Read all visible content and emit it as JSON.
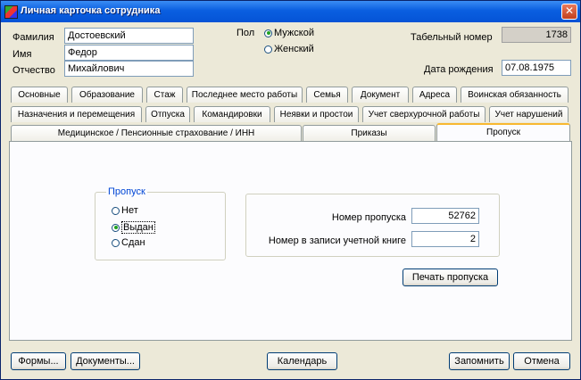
{
  "window": {
    "title": "Личная карточка сотрудника"
  },
  "person": {
    "surname_label": "Фамилия",
    "surname": "Достоевский",
    "name_label": "Имя",
    "name": "Федор",
    "patronymic_label": "Отчество",
    "patronymic": "Михайлович",
    "gender_label": "Пол",
    "gender_male": "Мужской",
    "gender_female": "Женский",
    "gender_selected": "male",
    "tabnum_label": "Табельный номер",
    "tabnum": "1738",
    "birth_label": "Дата рождения",
    "birth": "07.08.1975"
  },
  "tabs_row1": [
    "Основные",
    "Образование",
    "Стаж",
    "Последнее место работы",
    "Семья",
    "Документ",
    "Адреса",
    "Воинская обязанность"
  ],
  "tabs_row2": [
    "Назначения и перемещения",
    "Отпуска",
    "Командировки",
    "Неявки и простои",
    "Учет сверхурочной работы",
    "Учет нарушений"
  ],
  "tabs_row3": [
    "Медицинское / Пенсионные страхование / ИНН",
    "Приказы",
    "Пропуск"
  ],
  "active_tab": "Пропуск",
  "pass": {
    "group_label": "Пропуск",
    "opt_none": "Нет",
    "opt_issued": "Выдан",
    "opt_returned": "Сдан",
    "selected": "issued",
    "number_label": "Номер пропуска",
    "number": "52762",
    "book_label": "Номер в записи учетной книге",
    "book": "2",
    "print_button": "Печать пропуска"
  },
  "footer": {
    "forms": "Формы...",
    "documents": "Документы...",
    "calendar": "Календарь",
    "save": "Запомнить",
    "cancel": "Отмена"
  }
}
